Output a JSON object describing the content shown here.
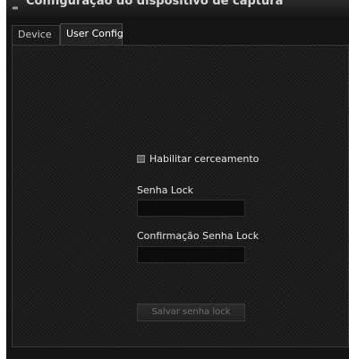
{
  "window": {
    "title": "Configuração do dispositivo de captura"
  },
  "tabs": [
    {
      "label": "Device",
      "active": false
    },
    {
      "label": "User Config",
      "active": true
    }
  ],
  "form": {
    "enable_lock_label": "Habilitar cerceamento",
    "enable_lock_checked": false,
    "password_label": "Senha Lock",
    "password_value": "",
    "password_placeholder": "",
    "confirm_label": "Confirmação Senha Lock",
    "confirm_value": "",
    "confirm_placeholder": "",
    "save_label": "Salvar senha lock",
    "save_enabled": false
  },
  "colors": {
    "background": "#141414",
    "panel": "#1d1d1d",
    "text": "#e6e6e6",
    "disabled_text": "#6e6e6e"
  }
}
